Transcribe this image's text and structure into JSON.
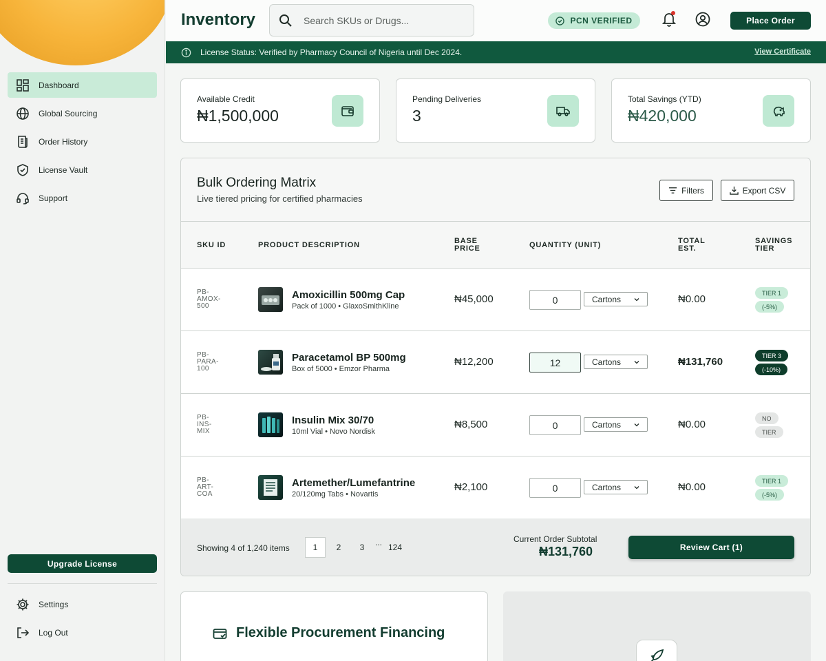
{
  "sidebar": {
    "items": [
      {
        "label": "Dashboard",
        "icon": "dashboard-icon",
        "active": true
      },
      {
        "label": "Global Sourcing",
        "icon": "globe-icon"
      },
      {
        "label": "Order History",
        "icon": "receipt-icon"
      },
      {
        "label": "License Vault",
        "icon": "shield-icon"
      },
      {
        "label": "Support",
        "icon": "headset-icon"
      }
    ],
    "upgrade_label": "Upgrade License",
    "bottom_items": [
      {
        "label": "Settings",
        "icon": "gear-icon"
      },
      {
        "label": "Log Out",
        "icon": "logout-icon"
      }
    ]
  },
  "header": {
    "title": "Inventory",
    "search_placeholder": "Search SKUs or Drugs...",
    "badge": "PCN VERIFIED",
    "place_order": "Place Order"
  },
  "license_bar": {
    "text": "License Status: Verified by Pharmacy Council of Nigeria until Dec 2024.",
    "link": "View Certificate"
  },
  "stats": [
    {
      "label": "Available Credit",
      "value": "₦1,500,000",
      "icon": "wallet-icon"
    },
    {
      "label": "Pending Deliveries",
      "value": "3",
      "icon": "truck-icon"
    },
    {
      "label": "Total Savings (YTD)",
      "value": "₦420,000",
      "icon": "piggy-bank-icon"
    }
  ],
  "matrix": {
    "title": "Bulk Ordering Matrix",
    "subtitle": "Live tiered pricing for certified pharmacies",
    "filters_label": "Filters",
    "export_label": "Export CSV",
    "columns": {
      "sku": "SKU ID",
      "product": "PRODUCT DESCRIPTION",
      "base_price_1": "BASE",
      "base_price_2": "PRICE",
      "quantity": "QUANTITY (UNIT)",
      "total_1": "TOTAL",
      "total_2": "EST.",
      "tier_1": "SAVINGS",
      "tier_2": "TIER"
    },
    "rows": [
      {
        "sku": [
          "PB-",
          "AMOX-",
          "500"
        ],
        "name": "Amoxicillin 500mg Cap",
        "desc": "Pack of 1000 • GlaxoSmithKline",
        "price": "₦45,000",
        "qty": "0",
        "unit": "Cartons",
        "total": "₦0.00",
        "tier": [
          "TIER 1",
          "(-5%)"
        ]
      },
      {
        "sku": [
          "PB-",
          "PARA-",
          "100"
        ],
        "name": "Paracetamol BP 500mg",
        "desc": "Box of 5000 • Emzor Pharma",
        "price": "₦12,200",
        "qty": "12",
        "unit": "Cartons",
        "total": "₦131,760",
        "tier": [
          "TIER 3",
          "(-10%)"
        ]
      },
      {
        "sku": [
          "PB-",
          "INS-",
          "MIX"
        ],
        "name": "Insulin Mix 30/70",
        "desc": "10ml Vial • Novo Nordisk",
        "price": "₦8,500",
        "qty": "0",
        "unit": "Cartons",
        "total": "₦0.00",
        "tier": [
          "NO",
          "TIER"
        ]
      },
      {
        "sku": [
          "PB-",
          "ART-",
          "COA"
        ],
        "name": "Artemether/Lumefantrine",
        "desc": "20/120mg Tabs • Novartis",
        "price": "₦2,100",
        "qty": "0",
        "unit": "Cartons",
        "total": "₦0.00",
        "tier": [
          "TIER 1",
          "(-5%)"
        ]
      }
    ],
    "footer": {
      "showing": "Showing 4 of 1,240 items",
      "pages": [
        "1",
        "2",
        "3",
        "...",
        "124"
      ],
      "subtotal_label": "Current Order Subtotal",
      "subtotal_value": "₦131,760",
      "review_label": "Review Cart (1)"
    }
  },
  "financing": {
    "title": "Flexible Procurement Financing",
    "icon": "credit-card-icon"
  },
  "promo": {
    "icon": "rocket-icon"
  },
  "colors": {
    "brand": "#0e4a35",
    "accent_light": "#c4ead6",
    "license_bar": "#10593e"
  }
}
